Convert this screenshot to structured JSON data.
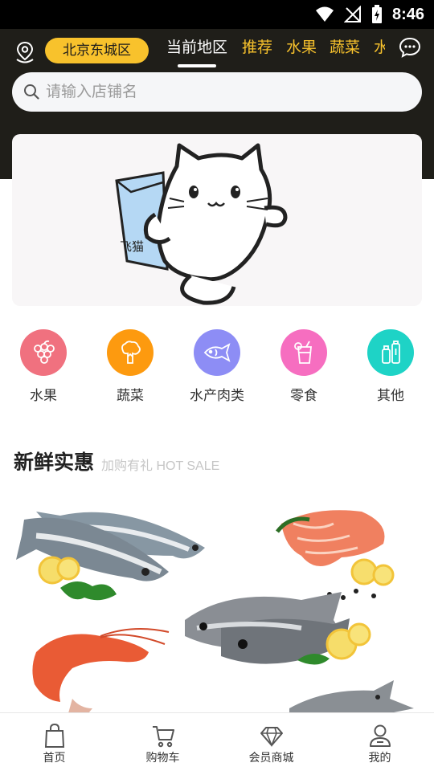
{
  "status_bar": {
    "time": "8:46"
  },
  "header": {
    "city": "北京东城区",
    "tabs": [
      {
        "label": "当前地区",
        "active": true
      },
      {
        "label": "推荐"
      },
      {
        "label": "水果"
      },
      {
        "label": "蔬菜"
      },
      {
        "label": "水"
      }
    ],
    "accent_color": "#f8c22c"
  },
  "search": {
    "placeholder": "请输入店铺名"
  },
  "banner": {
    "logo_text": "飞猫"
  },
  "categories": [
    {
      "label": "水果",
      "icon": "grape-icon",
      "color": "#f0717f"
    },
    {
      "label": "蔬菜",
      "icon": "broccoli-icon",
      "color": "#fd9a0f"
    },
    {
      "label": "水产肉类",
      "icon": "fish-icon",
      "color": "#8d8df5"
    },
    {
      "label": "零食",
      "icon": "drink-icon",
      "color": "#f66ec0"
    },
    {
      "label": "其他",
      "icon": "bottles-icon",
      "color": "#1ed3c6"
    }
  ],
  "section": {
    "title": "新鲜实惠",
    "subtitle": "加购有礼 HOT SALE"
  },
  "bottom_nav": [
    {
      "label": "首页",
      "icon": "bag-icon"
    },
    {
      "label": "购物车",
      "icon": "cart-icon"
    },
    {
      "label": "会员商城",
      "icon": "diamond-icon"
    },
    {
      "label": "我的",
      "icon": "user-icon"
    }
  ]
}
